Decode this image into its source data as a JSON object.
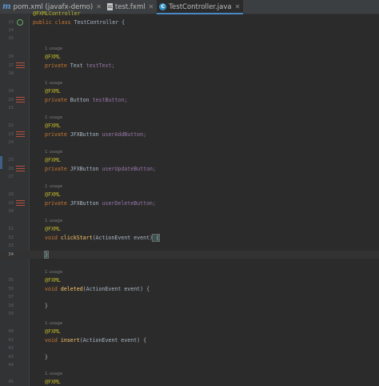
{
  "tabs": [
    {
      "label": "pom.xml (javafx-demo)",
      "icon": "maven-icon",
      "active": false
    },
    {
      "label": "test.fxml",
      "icon": "fxml-file-icon",
      "active": false
    },
    {
      "label": "TestController.java",
      "icon": "java-class-icon",
      "active": true
    }
  ],
  "editor": {
    "top_fragment": "@FXMLController",
    "class_decl": {
      "kw": "public class",
      "name": "TestController {"
    },
    "usage_hint": "1 usage",
    "annotation": "@FXML",
    "private_kw": "private",
    "void_kw": "void",
    "fields": [
      {
        "type": "Text",
        "name": "testText;"
      },
      {
        "type": "Button",
        "name": "testButton;"
      },
      {
        "type": "JFXButton",
        "name": "userAddButton;"
      },
      {
        "type": "JFXButton",
        "name": "userUpdateButton;"
      },
      {
        "type": "JFXButton",
        "name": "userDeleteButton;"
      }
    ],
    "methods": [
      {
        "name": "clickStart",
        "params": "(ActionEvent event)",
        "open": " {",
        "close": "}"
      },
      {
        "name": "deleted",
        "params": "(ActionEvent event)",
        "open": " {",
        "close": "}"
      },
      {
        "name": "insert",
        "params": "(ActionEvent event)",
        "open": " {",
        "close": "}"
      }
    ],
    "line_numbers": [
      "13",
      "14",
      "15",
      "16",
      "17",
      "18",
      "19",
      "20",
      "21",
      "22",
      "23",
      "24",
      "25",
      "26",
      "27",
      "28",
      "29",
      "30",
      "31",
      "32",
      "33",
      "34",
      "35",
      "36",
      "37",
      "38",
      "39",
      "40",
      "41",
      "42",
      "43",
      "44",
      "45"
    ]
  }
}
